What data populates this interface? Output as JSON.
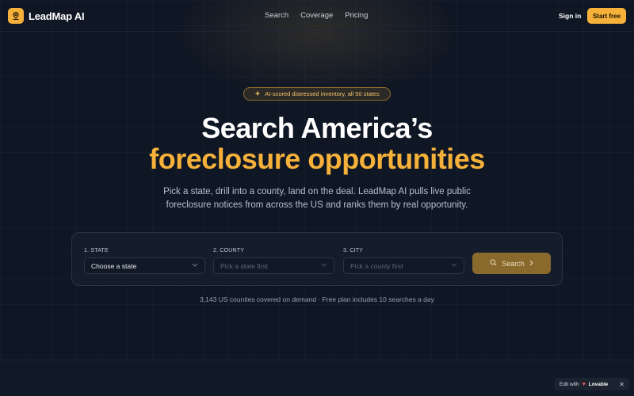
{
  "nav": {
    "brand": "LeadMap AI",
    "links": [
      "Search",
      "Coverage",
      "Pricing"
    ],
    "signin": "Sign in",
    "start": "Start free"
  },
  "hero": {
    "badge": "AI-scored distressed inventory, all 50 states",
    "title_line1": "Search America’s",
    "title_line2": "foreclosure opportunities",
    "subtitle": "Pick a state, drill into a county, land on the deal. LeadMap AI pulls live public foreclosure notices from across the US and ranks them by real opportunity."
  },
  "search": {
    "state_label": "1. STATE",
    "state_value": "Choose a state",
    "county_label": "2. COUNTY",
    "county_value": "Pick a state first",
    "city_label": "3. CITY",
    "city_value": "Pick a county first",
    "button": "Search"
  },
  "footnote": "3,143 US counties covered on demand · Free plan includes 10 searches a day",
  "edit_badge": {
    "prefix": "Edit with",
    "brand": "Lovable"
  },
  "colors": {
    "accent": "#f6b13a",
    "background": "#0f1624"
  }
}
